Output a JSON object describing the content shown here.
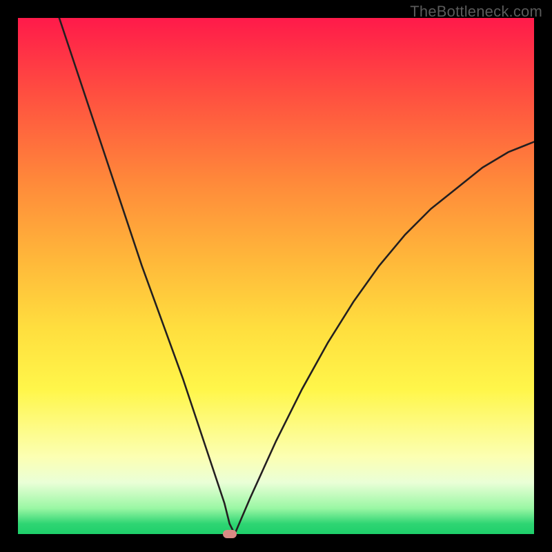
{
  "watermark": "TheBottleneck.com",
  "chart_data": {
    "type": "line",
    "title": "",
    "xlabel": "",
    "ylabel": "",
    "xlim": [
      0,
      100
    ],
    "ylim": [
      0,
      100
    ],
    "grid": false,
    "legend": false,
    "series": [
      {
        "name": "curve",
        "x": [
          8,
          12,
          16,
          20,
          24,
          28,
          32,
          36,
          38,
          40,
          41,
          42,
          45,
          50,
          55,
          60,
          65,
          70,
          75,
          80,
          85,
          90,
          95,
          100
        ],
        "y": [
          100,
          88,
          76,
          64,
          52,
          41,
          30,
          18,
          12,
          6,
          2,
          0,
          7,
          18,
          28,
          37,
          45,
          52,
          58,
          63,
          67,
          71,
          74,
          76
        ]
      }
    ],
    "marker": {
      "x": 41,
      "y": 0
    },
    "colors": {
      "curve": "#231f20",
      "marker": "#d98a84"
    }
  }
}
